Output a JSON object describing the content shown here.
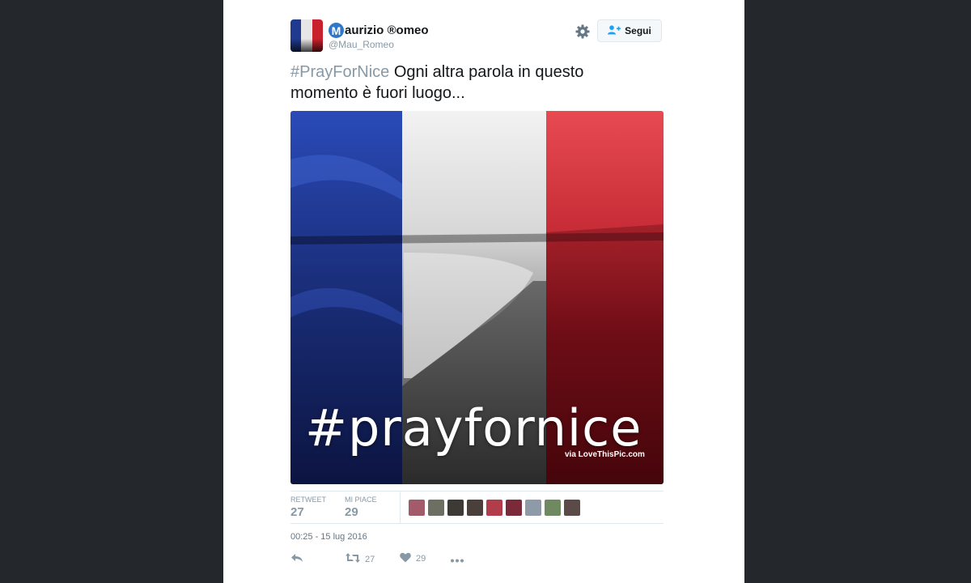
{
  "author": {
    "display_name": "aurizio ®omeo",
    "name_badge": "M",
    "handle": "@Mau_Romeo"
  },
  "header": {
    "follow_label": "Segui",
    "settings_icon": "gear-icon",
    "follow_icon": "add-user-icon"
  },
  "tweet": {
    "hashtag": "#PrayForNice",
    "text": " Ogni altra parola in questo momento è fuori luogo...",
    "image": {
      "overlay_text": "#prayfornice",
      "credit": "via LoveThisPic.com",
      "flag_colors": [
        "#1f3a8f",
        "#e8e8e8",
        "#c8202c"
      ]
    }
  },
  "stats": {
    "retweet_label": "RETWEET",
    "retweet_count": "27",
    "like_label": "MI PIACE",
    "like_count": "29",
    "likers_colors": [
      "#a35a6b",
      "#6d6f62",
      "#3d3a36",
      "#4a3f3a",
      "#b23d4a",
      "#7a2a38",
      "#8f9aa8",
      "#6f8a5e",
      "#5a4a48"
    ]
  },
  "timestamp": "00:25 - 15 lug 2016",
  "actions": {
    "reply_icon": "reply-icon",
    "retweet_icon": "retweet-icon",
    "retweet_count": "27",
    "like_icon": "heart-icon",
    "like_count": "29",
    "more_icon": "more-icon"
  },
  "colors": {
    "background": "#24272b",
    "card": "#ffffff",
    "muted": "#8899a6",
    "text": "#14171a"
  }
}
